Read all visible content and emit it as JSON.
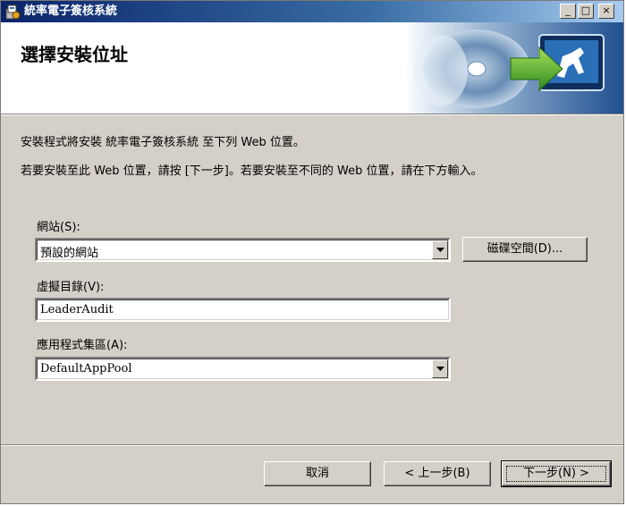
{
  "window": {
    "title": "統率電子簽核系統"
  },
  "titlebar_buttons": {
    "minimize": "_",
    "maximize": "□",
    "close": "×"
  },
  "header": {
    "title": "選擇安裝位址"
  },
  "description": {
    "line1": "安裝程式將安裝 統率電子簽核系統 至下列 Web 位置。",
    "line2": "若要安裝至此 Web 位置，請按 [下一步]。若要安裝至不同的 Web 位置，請在下方輸入。"
  },
  "form": {
    "site_label": "網站(S):",
    "site_value": "預設的網站",
    "disk_space_button": "磁碟空間(D)...",
    "vdir_label": "虛擬目錄(V):",
    "vdir_value": "LeaderAudit",
    "app_pool_label": "應用程式集區(A):",
    "app_pool_value": "DefaultAppPool"
  },
  "footer": {
    "cancel": "取消",
    "back": "< 上一步(B)",
    "next": "下一步(N) >"
  }
}
